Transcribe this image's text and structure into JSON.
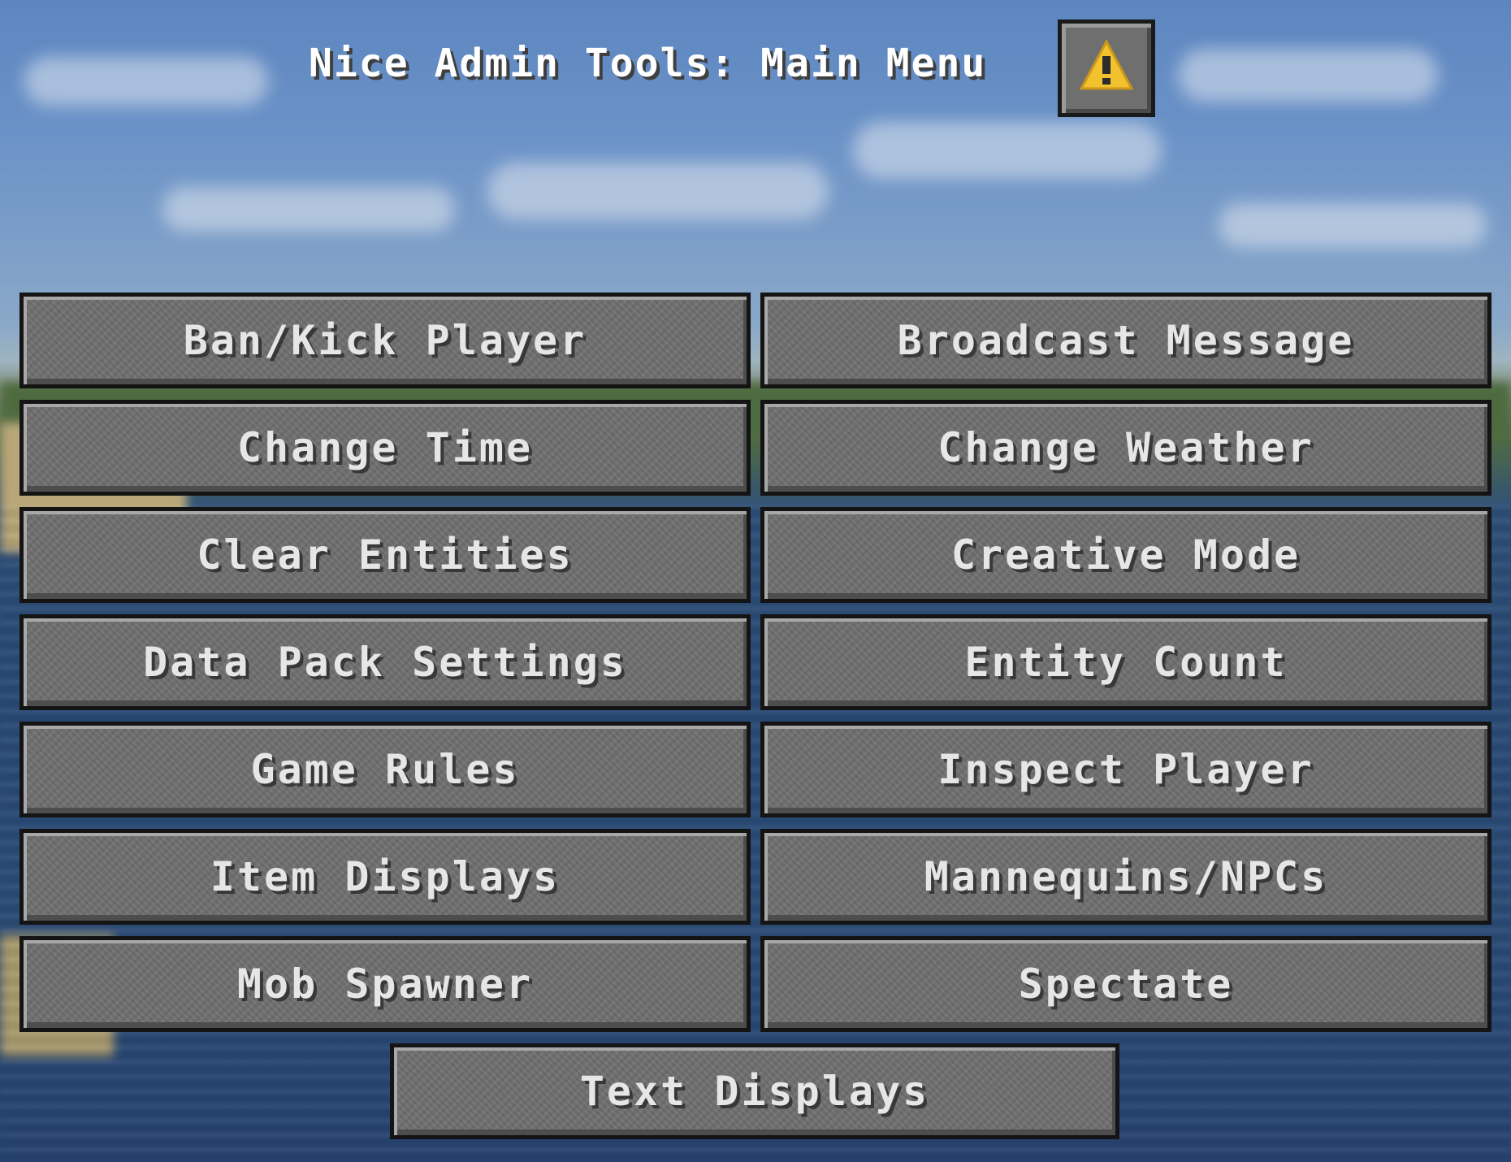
{
  "screen": {
    "title": "Nice Admin Tools: Main Menu",
    "warning_icon": "warning-triangle-icon",
    "warning_color": "#f2c12e"
  },
  "menu": {
    "buttons": [
      {
        "label": "Ban/Kick Player"
      },
      {
        "label": "Broadcast Message"
      },
      {
        "label": "Change Time"
      },
      {
        "label": "Change Weather"
      },
      {
        "label": "Clear Entities"
      },
      {
        "label": "Creative Mode"
      },
      {
        "label": "Data Pack Settings"
      },
      {
        "label": "Entity Count"
      },
      {
        "label": "Game Rules"
      },
      {
        "label": "Inspect Player"
      },
      {
        "label": "Item Displays"
      },
      {
        "label": "Mannequins/NPCs"
      },
      {
        "label": "Mob Spawner"
      },
      {
        "label": "Spectate"
      },
      {
        "label": "Text Displays"
      }
    ]
  }
}
